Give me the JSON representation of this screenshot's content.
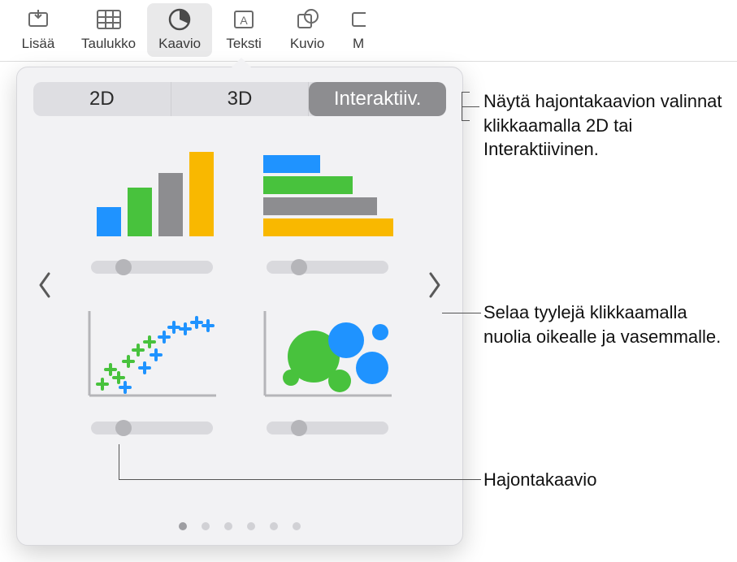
{
  "toolbar": {
    "items": [
      {
        "label": "Lisää",
        "icon": "insert"
      },
      {
        "label": "Taulukko",
        "icon": "table"
      },
      {
        "label": "Kaavio",
        "icon": "chart",
        "active": true
      },
      {
        "label": "Teksti",
        "icon": "text"
      },
      {
        "label": "Kuvio",
        "icon": "shape"
      },
      {
        "label": "M",
        "icon": "media",
        "truncated": true
      }
    ]
  },
  "popup": {
    "tabs": {
      "d2": "2D",
      "d3": "3D",
      "interactive": "Interaktiiv.",
      "selected": "interactive"
    },
    "pager": {
      "count": 6,
      "active": 0
    }
  },
  "annotations": {
    "tabs_hint": "Näytä hajontakaavion valinnat klikkaamalla 2D tai Interaktiivinen.",
    "arrows_hint": "Selaa tyylejä klikkaamalla nuolia oikealle ja vasemmalle.",
    "scatter_label": "Hajontakaavio"
  },
  "colors": {
    "blue": "#1f93ff",
    "green": "#48c23d",
    "gray": "#8d8d90",
    "orange": "#f9b800"
  }
}
